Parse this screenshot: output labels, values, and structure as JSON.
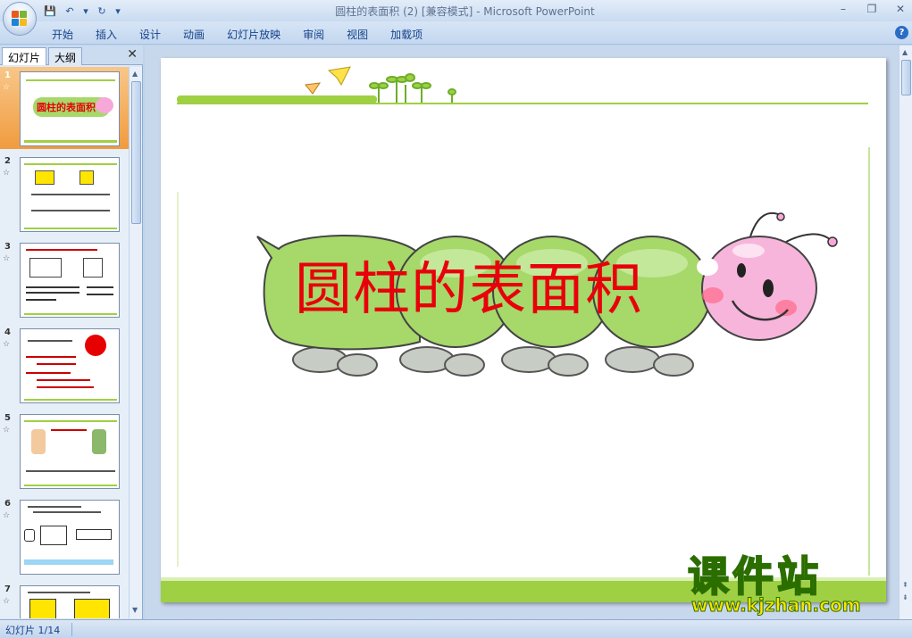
{
  "titlebar": {
    "title": "圆柱的表面积 (2) [兼容模式] - Microsoft PowerPoint",
    "minimize": "–",
    "restore": "❐",
    "close": "✕"
  },
  "qat": {
    "save_icon": "💾",
    "undo_icon": "↶",
    "redo_icon": "↻",
    "more_icon": "▾"
  },
  "ribbon": {
    "tabs": [
      "开始",
      "插入",
      "设计",
      "动画",
      "幻灯片放映",
      "审阅",
      "视图",
      "加载项"
    ],
    "help": "?"
  },
  "leftpane": {
    "tab_slides": "幻灯片",
    "tab_outline": "大纲",
    "close": "✕",
    "slides": [
      {
        "num": "1",
        "star": "☆"
      },
      {
        "num": "2",
        "star": "☆"
      },
      {
        "num": "3",
        "star": "☆"
      },
      {
        "num": "4",
        "star": "☆"
      },
      {
        "num": "5",
        "star": "☆"
      },
      {
        "num": "6",
        "star": "☆"
      },
      {
        "num": "7",
        "star": "☆"
      }
    ],
    "thumb1_title": "圆柱的表面积"
  },
  "slide": {
    "title": "圆柱的表面积"
  },
  "watermark": {
    "big": "课件站",
    "url": "www.kjzhan.com"
  },
  "statusbar": {
    "slide_counter": "幻灯片 1/14"
  },
  "colors": {
    "accent_green": "#9fd043",
    "title_red": "#e8000a",
    "caterpillar_green": "#a6d86a",
    "face_pink": "#f7a8d8",
    "selected_orange": "#f19b3f"
  }
}
